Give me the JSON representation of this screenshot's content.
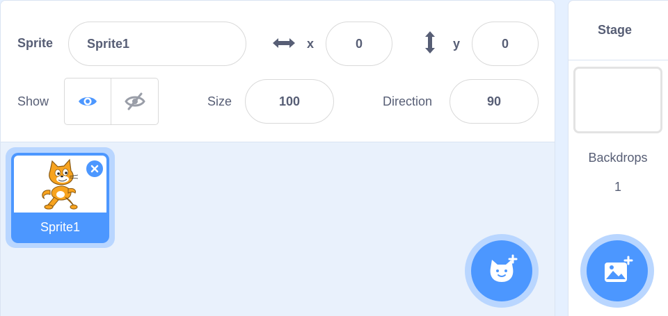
{
  "sprite_info": {
    "sprite_label": "Sprite",
    "sprite_name": "Sprite1",
    "x_label": "x",
    "x_value": "0",
    "y_label": "y",
    "y_value": "0",
    "show_label": "Show",
    "size_label": "Size",
    "size_value": "100",
    "direction_label": "Direction",
    "direction_value": "90"
  },
  "sprites": [
    {
      "name": "Sprite1",
      "selected": true
    }
  ],
  "stage": {
    "title": "Stage",
    "backdrops_label": "Backdrops",
    "backdrops_count": "1"
  },
  "colors": {
    "accent": "#4c97ff",
    "text": "#575e75"
  },
  "icons": [
    "left-right-arrow-icon",
    "up-down-arrow-icon",
    "eye-icon",
    "eye-hidden-icon",
    "close-icon",
    "cat-icon",
    "add-backdrop-icon"
  ]
}
